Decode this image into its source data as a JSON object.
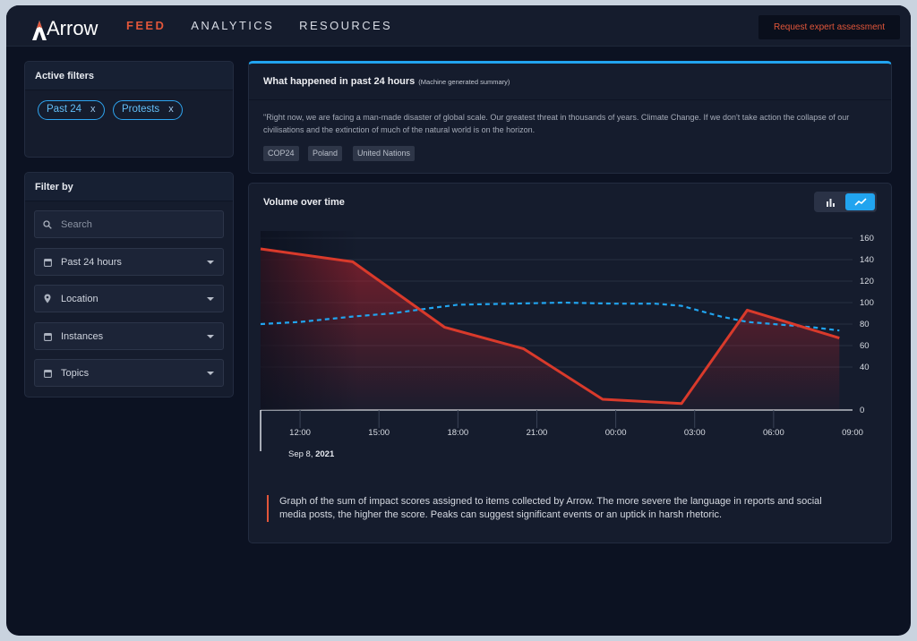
{
  "brand": {
    "name": "Arrow"
  },
  "nav": {
    "items": [
      {
        "label": "FEED",
        "active": true
      },
      {
        "label": "ANALYTICS",
        "active": false
      },
      {
        "label": "RESOURCES",
        "active": false
      }
    ]
  },
  "cta": {
    "label": "Request expert assessment"
  },
  "active_filters": {
    "title": "Active filters",
    "chips": [
      {
        "label": "Past 24",
        "remove": "x"
      },
      {
        "label": "Protests",
        "remove": "x"
      }
    ]
  },
  "filter_by": {
    "title": "Filter by",
    "search_placeholder": "Search",
    "selects": [
      {
        "label": "Past 24 hours",
        "icon": "calendar-icon"
      },
      {
        "label": "Location",
        "icon": "location-pin-icon"
      },
      {
        "label": "Instances",
        "icon": "calendar-icon"
      },
      {
        "label": "Topics",
        "icon": "calendar-icon"
      }
    ]
  },
  "summary": {
    "title": "What happened in past 24 hours",
    "subtitle": "(Machine generated summary)",
    "quote": "\"Right now, we are facing a man-made disaster of global scale. Our greatest threat in thousands of years. Climate Change. If we don't take action the collapse of our civilisations and the extinction of much of the natural world is on the horizon.",
    "tags": [
      "COP24",
      "Poland",
      "United Nations"
    ]
  },
  "volume": {
    "title": "Volume over time",
    "view_options": [
      "bar-chart-icon",
      "line-chart-icon"
    ],
    "active_view": "line-chart-icon",
    "note": "Graph of the sum of impact scores assigned to items collected by Arrow. The more severe the language in reports and social media posts, the higher the score. Peaks can suggest significant events or an uptick in harsh rhetoric."
  },
  "colors": {
    "accent": "#e2563a",
    "blue": "#21a4ef",
    "background": "#0c1222",
    "panel": "#151c2d"
  },
  "chart_data": {
    "type": "line",
    "title": "",
    "xlabel": "",
    "ylabel": "",
    "date_label_prefix": "Sep 8, ",
    "date_label_year": "2021",
    "x_ticks": [
      "12:00",
      "15:00",
      "18:00",
      "21:00",
      "00:00",
      "03:00",
      "06:00",
      "09:00"
    ],
    "y_ticks": [
      0,
      20,
      40,
      60,
      80,
      100,
      120,
      140,
      160
    ],
    "y_tick_labels": [
      "0",
      "40",
      "60",
      "80",
      "100",
      "120",
      "140",
      "160"
    ],
    "ylim": [
      0,
      160
    ],
    "x_range": [
      "Sep 8 10:30",
      "Sep 9 09:00"
    ],
    "grid": true,
    "series": [
      {
        "style": "solid",
        "color": "#d93a2b",
        "fill": "area",
        "points": [
          [
            "10:30",
            150
          ],
          [
            "14:00",
            138
          ],
          [
            "17:30",
            77
          ],
          [
            "20:30",
            57
          ],
          [
            "23:30",
            10
          ],
          [
            "02:30",
            6
          ],
          [
            "05:00",
            93
          ],
          [
            "08:30",
            67
          ]
        ]
      },
      {
        "style": "dashed",
        "color": "#21a4ef",
        "points": [
          [
            "10:30",
            80
          ],
          [
            "12:00",
            82
          ],
          [
            "14:00",
            87
          ],
          [
            "15:30",
            90
          ],
          [
            "17:00",
            95
          ],
          [
            "18:00",
            98
          ],
          [
            "20:00",
            99
          ],
          [
            "22:00",
            100
          ],
          [
            "00:00",
            99
          ],
          [
            "01:30",
            99
          ],
          [
            "02:30",
            97
          ],
          [
            "04:00",
            87
          ],
          [
            "05:00",
            82
          ],
          [
            "06:00",
            80
          ],
          [
            "07:30",
            77
          ],
          [
            "08:30",
            74
          ]
        ]
      }
    ]
  }
}
